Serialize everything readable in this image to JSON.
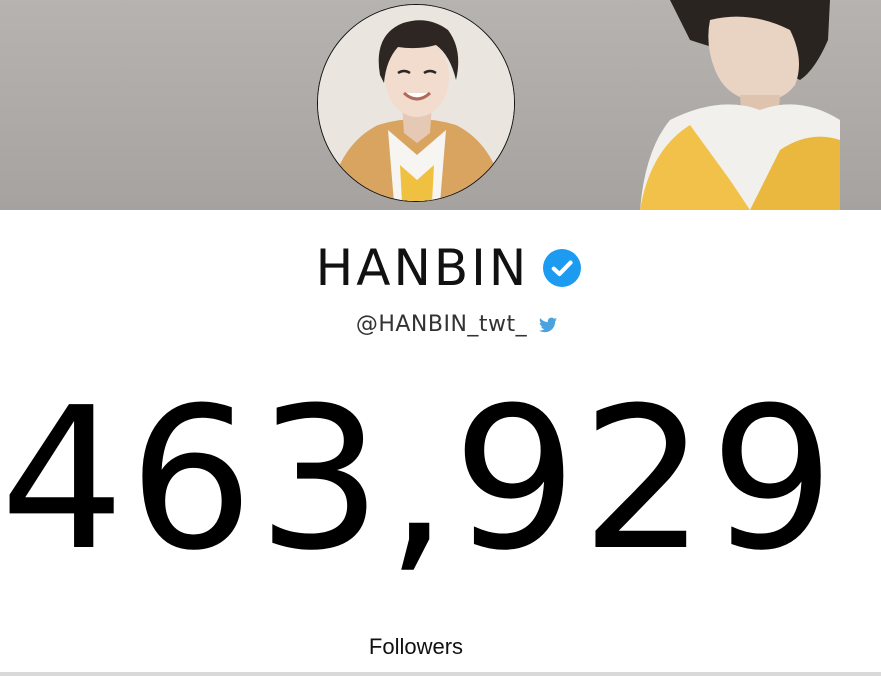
{
  "profile": {
    "name": "HANBIN",
    "handle": "@HANBIN_twt_",
    "verified": true
  },
  "stats": {
    "count": "463,929",
    "label": "Followers"
  },
  "icons": {
    "verified": "verified-badge-icon",
    "platform": "twitter-bird-icon"
  },
  "colors": {
    "verified_blue": "#1d9bf0",
    "twitter_blue": "#4aa3df",
    "banner_gray": "#b0adaa"
  }
}
